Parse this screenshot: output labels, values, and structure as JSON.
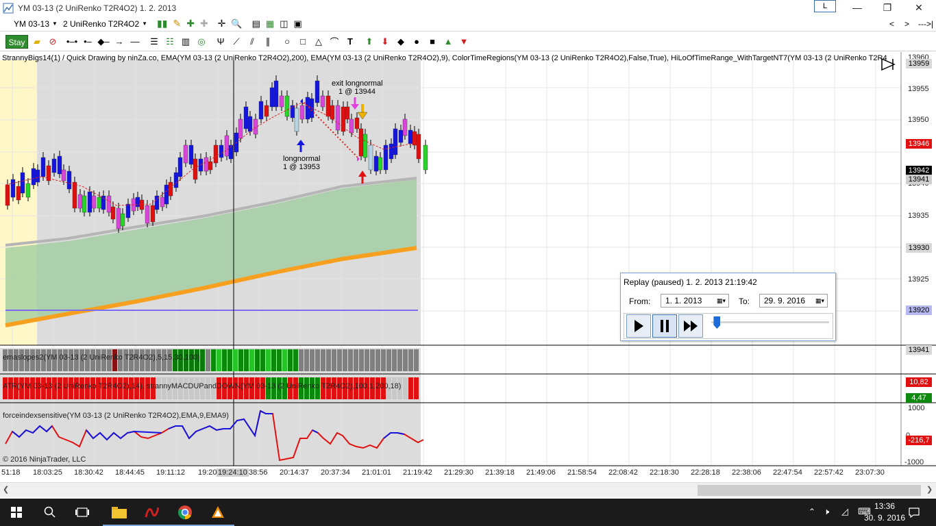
{
  "window": {
    "title": "YM 03-13 (2 UniRenko T2R4O2)  1. 2. 2013",
    "l_button": "L",
    "minimize": "—",
    "restore": "❐",
    "close": "✕"
  },
  "toolbar1": {
    "instrument": "YM 03-13",
    "bar_type": "2 UniRenko T2R4O2",
    "nav_prev": "<",
    "nav_next": ">",
    "nav_end": "--->|"
  },
  "toolbar2": {
    "stay_label": "Stay"
  },
  "indicators_line": "StrannyBigs14(1) / Quick Drawing by ninZa.co, EMA(YM 03-13 (2 UniRenko T2R4O2),200), EMA(YM 03-13 (2 UniRenko T2R4O2),9), ColorTimeRegions(YM 03-13 (2 UniRenko T2R4O2),False,True), HiLoOfTimeRange_WithTargetNT7(YM 03-13 (2 UniRenko T2R4",
  "price_axis": {
    "labels": [
      "13960",
      "13955",
      "13950",
      "13945",
      "13940",
      "13935",
      "13930",
      "13925",
      "13920"
    ],
    "tags": [
      {
        "text": "13959",
        "bg": "#d8d8d8",
        "fg": "#000"
      },
      {
        "text": "13946",
        "bg": "#e01010",
        "fg": "#fff"
      },
      {
        "text": "13942",
        "bg": "#000000",
        "fg": "#fff"
      },
      {
        "text": "13941",
        "bg": "#cfcfcf",
        "fg": "#000"
      },
      {
        "text": "13930",
        "bg": "#d8d8d8",
        "fg": "#000"
      },
      {
        "text": "13920",
        "bg": "#b8b8f0",
        "fg": "#000"
      }
    ]
  },
  "annotations": {
    "exit_label": "exit longnormal",
    "exit_qty": "1 @ 13944",
    "entry_label": "longnormal",
    "entry_qty": "1 @ 13953"
  },
  "panels": {
    "emaslopes": "emaslopes2(YM 03-13 (2 UniRenko T2R4O2),5,15,30,100)",
    "emaslopes_tag": "13941",
    "atr": "ATR(YM 03-13 (2 UniRenko T2R4O2),14), strannyMACDUPandDOWN(YM 03-13 (2 UniRenko T2R4O2),100,1,200,18)",
    "atr_tag1": "10,82",
    "atr_tag2": "4,47",
    "force": "forceindexsensitive(YM 03-13 (2 UniRenko T2R4O2),EMA,9,EMA9)",
    "force_axis_top": "1000",
    "force_axis_bottom": "-1000",
    "force_tag": "-216,7",
    "force_zero": "0",
    "copyright": "© 2016 NinjaTrader, LLC"
  },
  "time_axis": [
    "51:18",
    "18:03:25",
    "18:30:42",
    "18:44:45",
    "19:11:12",
    "19:20:",
    "19:24:10",
    "38:56",
    "20:14:37",
    "20:37:34",
    "21:01:01",
    "21:19:42",
    "21:29:30",
    "21:39:18",
    "21:49:06",
    "21:58:54",
    "22:08:42",
    "22:18:30",
    "22:28:18",
    "22:38:06",
    "22:47:54",
    "22:57:42",
    "23:07:30"
  ],
  "replay": {
    "title": "Replay (paused) 1. 2. 2013 21:19:42",
    "from_label": "From:",
    "from_value": "1.   1. 2013",
    "to_label": "To:",
    "to_value": "29.   9. 2016",
    "progress": 0.02
  },
  "taskbar": {
    "time": "13:36",
    "date": "30. 9. 2016"
  },
  "colors": {
    "bull": "#1515e0",
    "bear": "#e01010",
    "bull_alt": "#27d427",
    "bear_alt": "#d946d9",
    "ema200": "#f7a020",
    "shade": "#dcdcdc",
    "highlight": "#fff7c7"
  }
}
